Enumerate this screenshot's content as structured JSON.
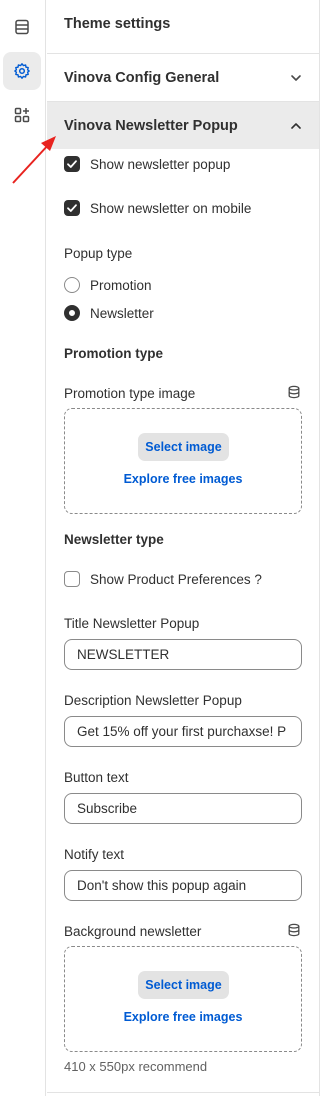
{
  "rail": {
    "items": [
      {
        "icon": "sections-icon"
      },
      {
        "icon": "gear-icon"
      },
      {
        "icon": "apps-icon"
      }
    ]
  },
  "panel": {
    "title": "Theme settings",
    "sections": [
      {
        "label": "Vinova Config General"
      },
      {
        "label": "Vinova Newsletter Popup"
      }
    ]
  },
  "newsletter": {
    "show_popup_label": "Show newsletter popup",
    "show_mobile_label": "Show newsletter on mobile",
    "popup_type_label": "Popup type",
    "popup_type_options": [
      "Promotion",
      "Newsletter"
    ],
    "popup_type_selected": "Newsletter",
    "promotion_type_heading": "Promotion type",
    "promotion_image_label": "Promotion type image",
    "select_image_label": "Select image",
    "explore_label": "Explore free images",
    "newsletter_type_heading": "Newsletter type",
    "show_product_prefs_label": "Show Product Preferences ?",
    "title_label": "Title Newsletter Popup",
    "title_value": "NEWSLETTER",
    "description_label": "Description Newsletter Popup",
    "description_value": "Get 15% off your first purchaxse! P",
    "button_text_label": "Button text",
    "button_text_value": "Subscribe",
    "notify_text_label": "Notify text",
    "notify_text_value": "Don't show this popup again",
    "background_label": "Background newsletter",
    "background_hint": "410 x 550px recommend"
  },
  "colors": {
    "accent_link": "#005bd3",
    "annotation_arrow": "#e8231f"
  }
}
